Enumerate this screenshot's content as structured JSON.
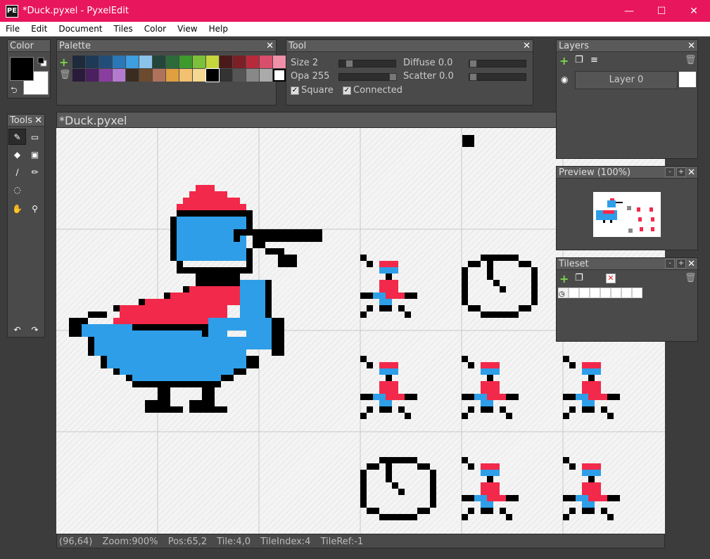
{
  "window": {
    "title": "*Duck.pyxel - PyxelEdit",
    "app_icon": "PE",
    "minimize": "—",
    "maximize": "☐",
    "close": "✕"
  },
  "menu": [
    "File",
    "Edit",
    "Document",
    "Tiles",
    "Color",
    "View",
    "Help"
  ],
  "panels": {
    "color": {
      "title": "Color"
    },
    "palette": {
      "title": "Palette",
      "colors": [
        "#1e2b3c",
        "#1f3a56",
        "#214e78",
        "#2a78b8",
        "#3d9ee0",
        "#8ac4ea",
        "#24463a",
        "#2d6b3b",
        "#3f9a2e",
        "#7cc13a",
        "#c5d63d",
        "#4a1a1a",
        "#7c1f26",
        "#b82a3a",
        "#d94e6a",
        "#ef8fa8",
        "#2a1b3a",
        "#4a2060",
        "#8a3ea0",
        "#b47ad0",
        "#3b2c22",
        "#6b4a2e",
        "#b0725a",
        "#e0a040",
        "#f2c070",
        "#f5d890",
        "#000000",
        "#333333",
        "#555555",
        "#888888",
        "#aaaaaa",
        "#ffffff"
      ]
    },
    "tool": {
      "title": "Tool",
      "size_label": "Size 2",
      "opa_label": "Opa 255",
      "diffuse_label": "Diffuse 0.0",
      "scatter_label": "Scatter 0.0",
      "size_value": 2,
      "opa_value": 255,
      "diffuse_value": 0.0,
      "scatter_value": 0.0,
      "square_label": "Square",
      "connected_label": "Connected",
      "square_checked": true,
      "connected_checked": true
    },
    "tools": {
      "title": "Tools"
    },
    "layers": {
      "title": "Layers",
      "layer_name": "Layer 0"
    },
    "preview": {
      "title": "Preview (100%)"
    },
    "tileset": {
      "title": "Tileset"
    }
  },
  "document": {
    "tab_title": "*Duck.pyxel"
  },
  "status": {
    "coords": "(96,64)",
    "zoom": "Zoom:900%",
    "pos": "Pos:65,2",
    "tile": "Tile:4,0",
    "tile_index": "TileIndex:4",
    "tile_ref": "TileRef:-1"
  },
  "colors": {
    "accent": "#e8165c",
    "duck_blue": "#2e9ee8",
    "duck_red": "#f2294a",
    "outline": "#000000"
  }
}
